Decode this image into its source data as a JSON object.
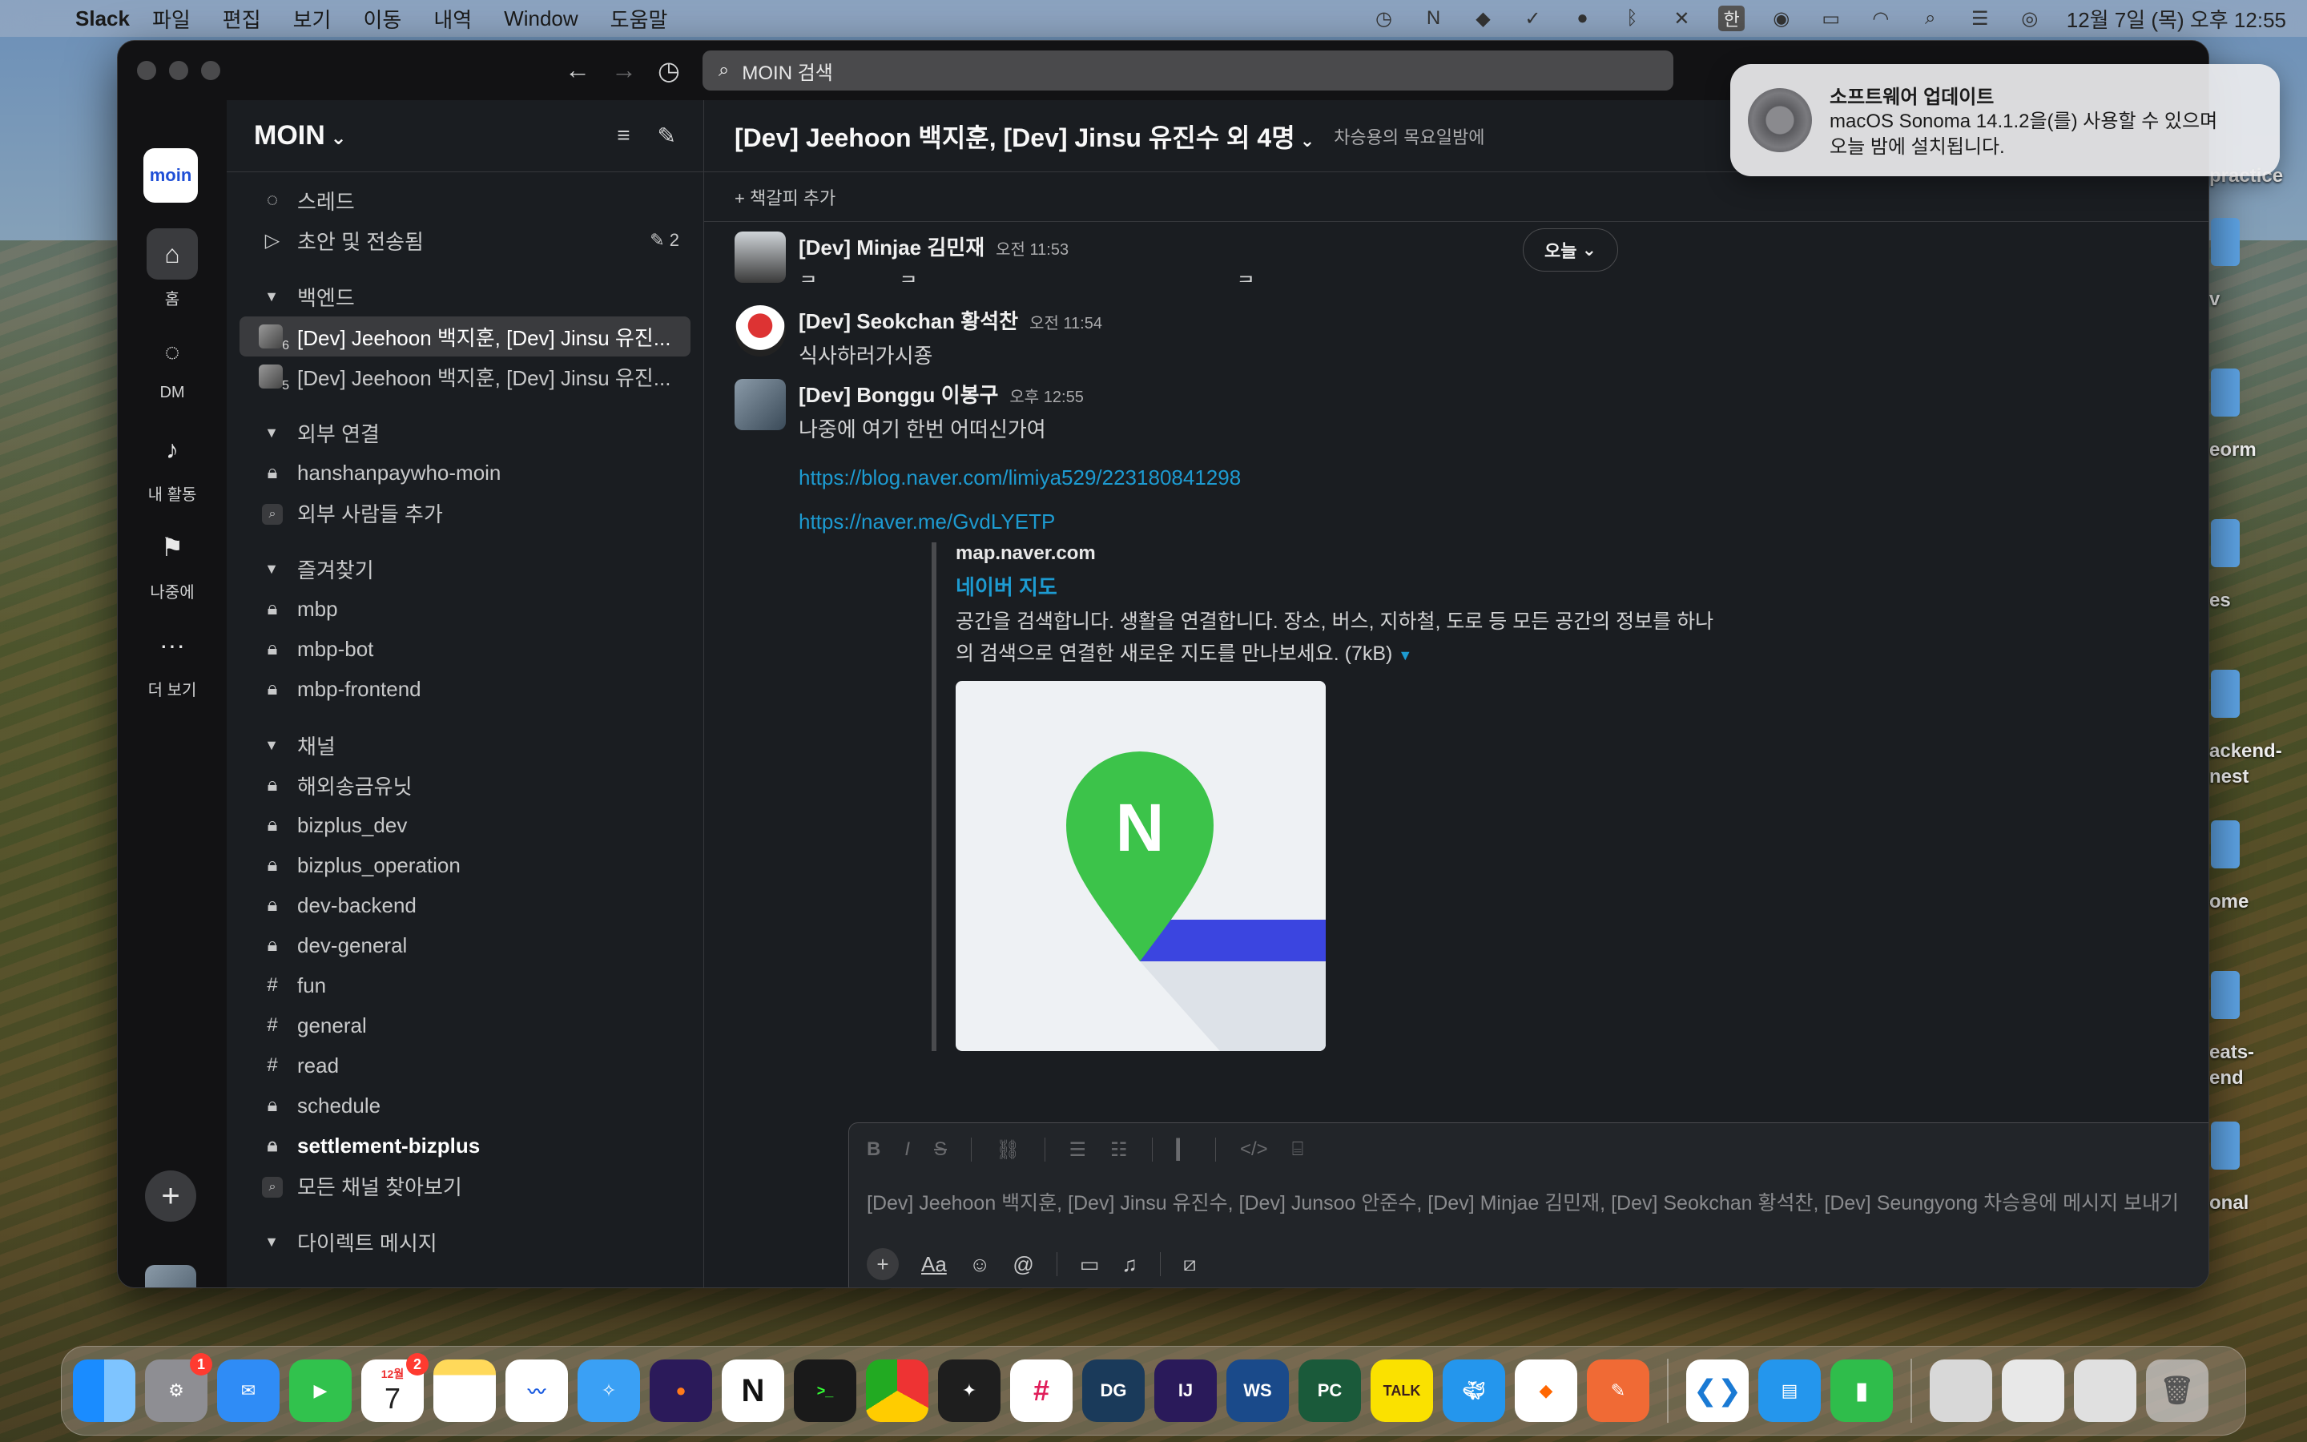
{
  "menubar": {
    "app": "Slack",
    "menus": [
      "파일",
      "편집",
      "보기",
      "이동",
      "내역",
      "Window",
      "도움말"
    ],
    "ime": "한",
    "clock": "12월 7일 (목) 오후 12:55"
  },
  "titlebar": {
    "search_placeholder": "MOIN 검색"
  },
  "rail": {
    "workspace_logo": "moin",
    "items": [
      {
        "label": "홈",
        "icon": "home-icon"
      },
      {
        "label": "DM",
        "icon": "dm-icon"
      },
      {
        "label": "내 활동",
        "icon": "bell-icon"
      },
      {
        "label": "나중에",
        "icon": "bookmark-icon"
      },
      {
        "label": "더 보기",
        "icon": "more-icon"
      }
    ]
  },
  "sidebar": {
    "workspace": "MOIN",
    "top": [
      {
        "label": "스레드",
        "icon": "threads-icon"
      },
      {
        "label": "초안 및 전송됨",
        "icon": "send-icon",
        "badge": "2"
      }
    ],
    "sections": [
      {
        "title": "백엔드",
        "items": [
          {
            "label": "[Dev] Jeehoon 백지훈, [Dev] Jinsu 유진...",
            "type": "dm",
            "count": "6",
            "selected": true
          },
          {
            "label": "[Dev] Jeehoon 백지훈, [Dev] Jinsu 유진...",
            "type": "dm",
            "count": "5"
          }
        ]
      },
      {
        "title": "외부 연결",
        "items": [
          {
            "label": "hanshanpaywho-moin",
            "type": "lock"
          },
          {
            "label": "외부 사람들 추가",
            "type": "search"
          }
        ]
      },
      {
        "title": "즐겨찾기",
        "items": [
          {
            "label": "mbp",
            "type": "lock"
          },
          {
            "label": "mbp-bot",
            "type": "lock"
          },
          {
            "label": "mbp-frontend",
            "type": "lock"
          }
        ]
      },
      {
        "title": "채널",
        "items": [
          {
            "label": "해외송금유닛",
            "type": "lock"
          },
          {
            "label": "bizplus_dev",
            "type": "lock"
          },
          {
            "label": "bizplus_operation",
            "type": "lock"
          },
          {
            "label": "dev-backend",
            "type": "lock"
          },
          {
            "label": "dev-general",
            "type": "lock"
          },
          {
            "label": "fun",
            "type": "hash"
          },
          {
            "label": "general",
            "type": "hash"
          },
          {
            "label": "read",
            "type": "hash"
          },
          {
            "label": "schedule",
            "type": "lock"
          },
          {
            "label": "settlement-bizplus",
            "type": "lock",
            "bold": true
          },
          {
            "label": "모든 채널 찾아보기",
            "type": "search"
          }
        ]
      },
      {
        "title": "다이렉트 메시지",
        "items": []
      }
    ]
  },
  "channel": {
    "title": "[Dev] Jeehoon 백지훈, [Dev] Jinsu 유진수 외 4명",
    "topic": "차승용의 목요일밤에",
    "add_bookmark": "+ 책갈피 추가",
    "today": "오늘"
  },
  "messages": [
    {
      "name": "[Dev] Minjae 김민재",
      "time": "오전 11:53",
      "text": "ㅋ              ㅋ                                                       ㅋ"
    },
    {
      "name": "[Dev] Seokchan 황석찬",
      "time": "오전 11:54",
      "text": "식사하러가시죵"
    },
    {
      "name": "[Dev] Bonggu 이봉구",
      "time": "오후 12:55",
      "text": "나중에 여기 한번 어떠신가여",
      "links": [
        "https://blog.naver.com/limiya529/223180841298",
        "https://naver.me/GvdLYETP"
      ]
    }
  ],
  "unfurl": {
    "site": "map.naver.com",
    "title": "네이버 지도",
    "desc_line1": "공간을 검색합니다. 생활을 연결합니다. 장소, 버스, 지하철, 도로 등 모든 공간의 정보를 하나",
    "desc_line2": "의 검색으로 연결한 새로운 지도를 만나보세요. (7kB)"
  },
  "composer": {
    "placeholder": "[Dev] Jeehoon 백지훈, [Dev] Jinsu 유진수, [Dev] Junsoo 안준수, [Dev] Minjae 김민재, [Dev] Seokchan 황석찬, [Dev] Seungyong 차승용에 메시지 보내기",
    "aa": "Aa"
  },
  "notification": {
    "title": "소프트웨어 업데이트",
    "line1": "macOS Sonoma 14.1.2을(를) 사용할 수 있으며",
    "line2": "오늘 밤에 설치됩니다."
  },
  "desktop_labels": [
    "practice",
    "v",
    "eorm",
    "es",
    "ackend-",
    "nest",
    "ome",
    "eats-",
    "end",
    "onal"
  ],
  "dock": {
    "calendar_month": "12월",
    "calendar_day": "7",
    "settings_badge": "1",
    "calendar_badge": "2",
    "labels": [
      "DG",
      "IJ",
      "WS",
      "PC",
      "TALK"
    ]
  },
  "colors": {
    "sidebar_bg": "#1a1d21",
    "link": "#1d9bd1",
    "online": "#2bac76"
  }
}
